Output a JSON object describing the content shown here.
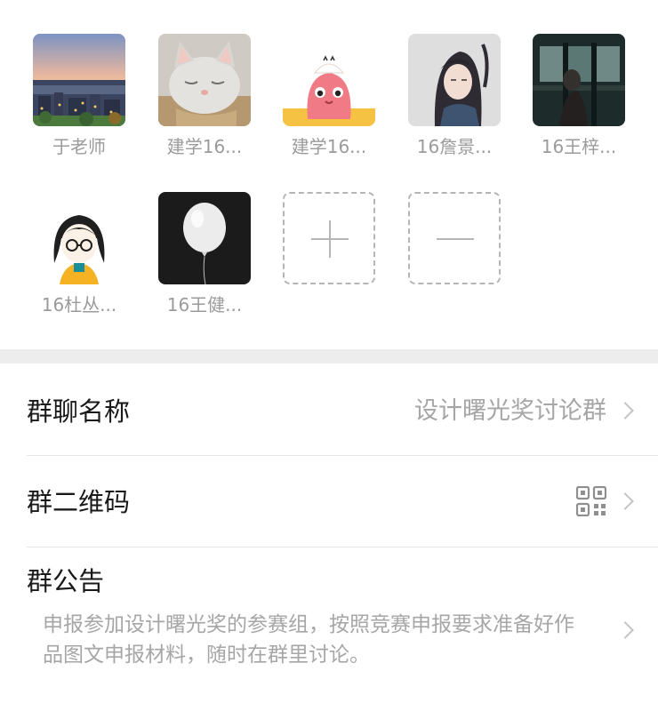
{
  "members": [
    {
      "name": "于老师",
      "avatar": "city-skyline-photo"
    },
    {
      "name": "建学16...",
      "avatar": "sleeping-cat-photo"
    },
    {
      "name": "建学16...",
      "avatar": "pink-bird-cartoon"
    },
    {
      "name": "16詹景...",
      "avatar": "anime-character"
    },
    {
      "name": "16王梓...",
      "avatar": "dark-train-photo"
    },
    {
      "name": "16杜丛...",
      "avatar": "girl-with-glasses-cartoon"
    },
    {
      "name": "16王健...",
      "avatar": "white-balloon-photo"
    }
  ],
  "actions": {
    "add": "plus-icon",
    "remove": "minus-icon"
  },
  "settings": {
    "group_name": {
      "label": "群聊名称",
      "value": "设计曙光奖讨论群"
    },
    "qr_code": {
      "label": "群二维码",
      "icon": "qr-code-icon"
    },
    "notice": {
      "label": "群公告",
      "text": "申报参加设计曙光奖的参赛组，按照竞赛申报要求准备好作品图文申报材料，随时在群里讨论。"
    }
  },
  "colors": {
    "background": "#ffffff",
    "divider_band": "#ededed",
    "secondary_text": "#a6a6a6",
    "primary_text": "#1a1a1a"
  }
}
